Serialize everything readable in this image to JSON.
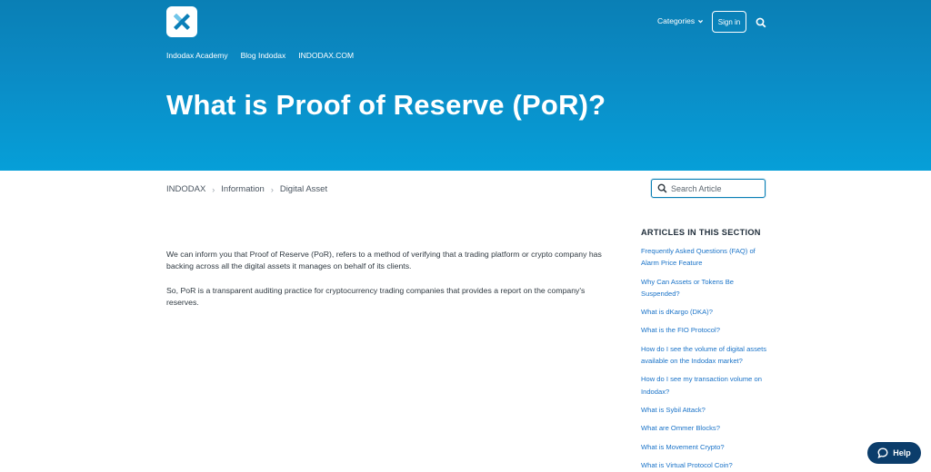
{
  "header": {
    "logo_icon": "indodax-x-logo",
    "nav_links": [
      "Indodax Academy",
      "Blog Indodax",
      "INDODAX.COM"
    ],
    "categories_label": "Categories",
    "signin_label": "Sign in",
    "search_icon": "search-icon"
  },
  "page": {
    "title": "What is Proof of Reserve (PoR)?"
  },
  "breadcrumb": [
    "INDODAX",
    "Information",
    "Digital Asset"
  ],
  "search": {
    "placeholder": "Search Article"
  },
  "article": {
    "paragraphs": [
      "We can inform you that Proof of Reserve (PoR), refers to a method of verifying that a trading platform or crypto company has backing across all the digital assets it manages on behalf of its clients.",
      "So, PoR is a transparent auditing practice for cryptocurrency trading companies that provides a report on the company's reserves."
    ]
  },
  "sidebar": {
    "heading": "ARTICLES IN THIS SECTION",
    "items": [
      "Frequently Asked Questions (FAQ) of Alarm Price Feature",
      "Why Can Assets or Tokens Be Suspended?",
      "What is dKargo (DKA)?",
      "What is the FIO Protocol?",
      "How do I see the volume of digital assets available on the Indodax market?",
      "How do I see my transaction volume on Indodax?",
      "What is Sybil Attack?",
      "What are Ommer Blocks?",
      "What is Movement Crypto?",
      "What is Virtual Protocol Coin?"
    ]
  },
  "help": {
    "label": "Help"
  },
  "colors": {
    "hero_top": "#0a7fb5",
    "hero_bottom": "#069fd8",
    "link": "#1a73c8",
    "help_bg": "#0b3d6b"
  }
}
